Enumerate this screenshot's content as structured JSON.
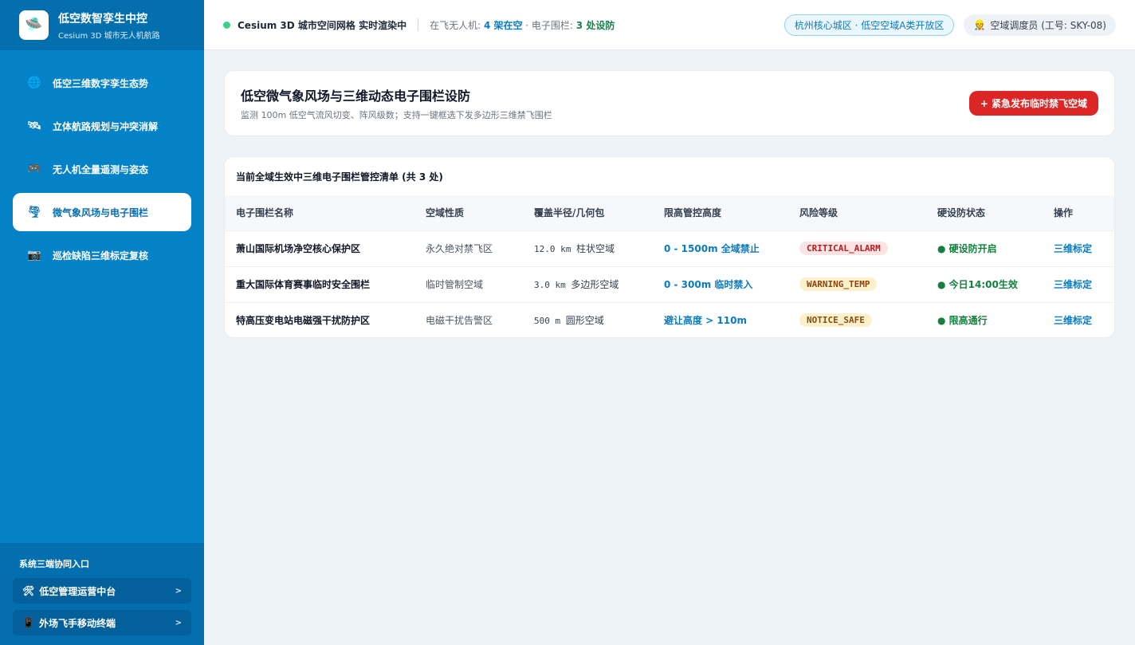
{
  "brand": {
    "title": "低空数智孪生中控",
    "subtitle": "Cesium 3D 城市无人机航路",
    "logo_icon": "ufo-icon"
  },
  "sidebar": {
    "items": [
      {
        "label": "低空三维数字孪生态势",
        "icon": "🌐",
        "icon_name": "globe-icon",
        "active": false
      },
      {
        "label": "立体航路规划与冲突消解",
        "icon": "🛰",
        "icon_name": "satellite-icon",
        "active": false
      },
      {
        "label": "无人机全量遥测与姿态",
        "icon": "🎮",
        "icon_name": "gamepad-icon",
        "active": false
      },
      {
        "label": "微气象风场与电子围栏",
        "icon": "🌪",
        "icon_name": "tornado-icon",
        "active": true
      },
      {
        "label": "巡检缺陷三维标定复核",
        "icon": "📷",
        "icon_name": "camera-icon",
        "active": false
      }
    ],
    "bottom_title": "系统三端协同入口",
    "links": [
      {
        "label": "低空管理运营中台",
        "icon": "🛠",
        "icon_name": "tools-icon",
        "arrow": ">"
      },
      {
        "label": "外场飞手移动终端",
        "icon": "📱",
        "icon_name": "mobile-icon",
        "arrow": ">"
      }
    ]
  },
  "topbar": {
    "status_main": "Cesium 3D 城市空间网格 实时渲染中",
    "meta_prefix": "在飞无人机: ",
    "drones": "4 架在空",
    "meta_mid": " · 电子围栏: ",
    "fences": "3 处设防",
    "zone": "杭州核心城区 · 低空空域A类开放区",
    "user": "空域调度员 (工号: SKY-08)",
    "user_icon": "👷"
  },
  "header": {
    "title": "低空微气象风场与三维动态电子围栏设防",
    "subtitle": "监测 100m 低空气流风切变、阵风级数；支持一键框选下发多边形三维禁飞围栏",
    "button": "+ 紧急发布临时禁飞空域"
  },
  "table": {
    "caption": "当前全域生效中三维电子围栏管控清单 (共 3 处)",
    "columns": [
      "电子围栏名称",
      "空域性质",
      "覆盖半径/几何包",
      "限高管控高度",
      "风险等级",
      "硬设防状态",
      "操作"
    ],
    "rows": [
      {
        "name": "萧山国际机场净空核心保护区",
        "nature": "永久绝对禁飞区",
        "radius": "12.0 km",
        "shape": "柱状空域",
        "altitude": "0 - 1500m 全域禁止",
        "risk": "CRITICAL_ALARM",
        "state": "● 硬设防开启",
        "op": "三维标定"
      },
      {
        "name": "重大国际体育赛事临时安全围栏",
        "nature": "临时管制空域",
        "radius": "3.0 km",
        "shape": "多边形空域",
        "altitude": "0 - 300m 临时禁入",
        "risk": "WARNING_TEMP",
        "state": "● 今日14:00生效",
        "op": "三维标定"
      },
      {
        "name": "特高压变电站电磁强干扰防护区",
        "nature": "电磁干扰告警区",
        "radius": "500 m",
        "shape": "圆形空域",
        "altitude": "避让高度 > 110m",
        "risk": "NOTICE_SAFE",
        "state": "● 限高通行",
        "op": "三维标定"
      }
    ]
  },
  "colors": {
    "sidebar": "#0482c8",
    "accent": "#0a7bc2",
    "danger": "#dc2626",
    "live": "#3ecf8e"
  }
}
